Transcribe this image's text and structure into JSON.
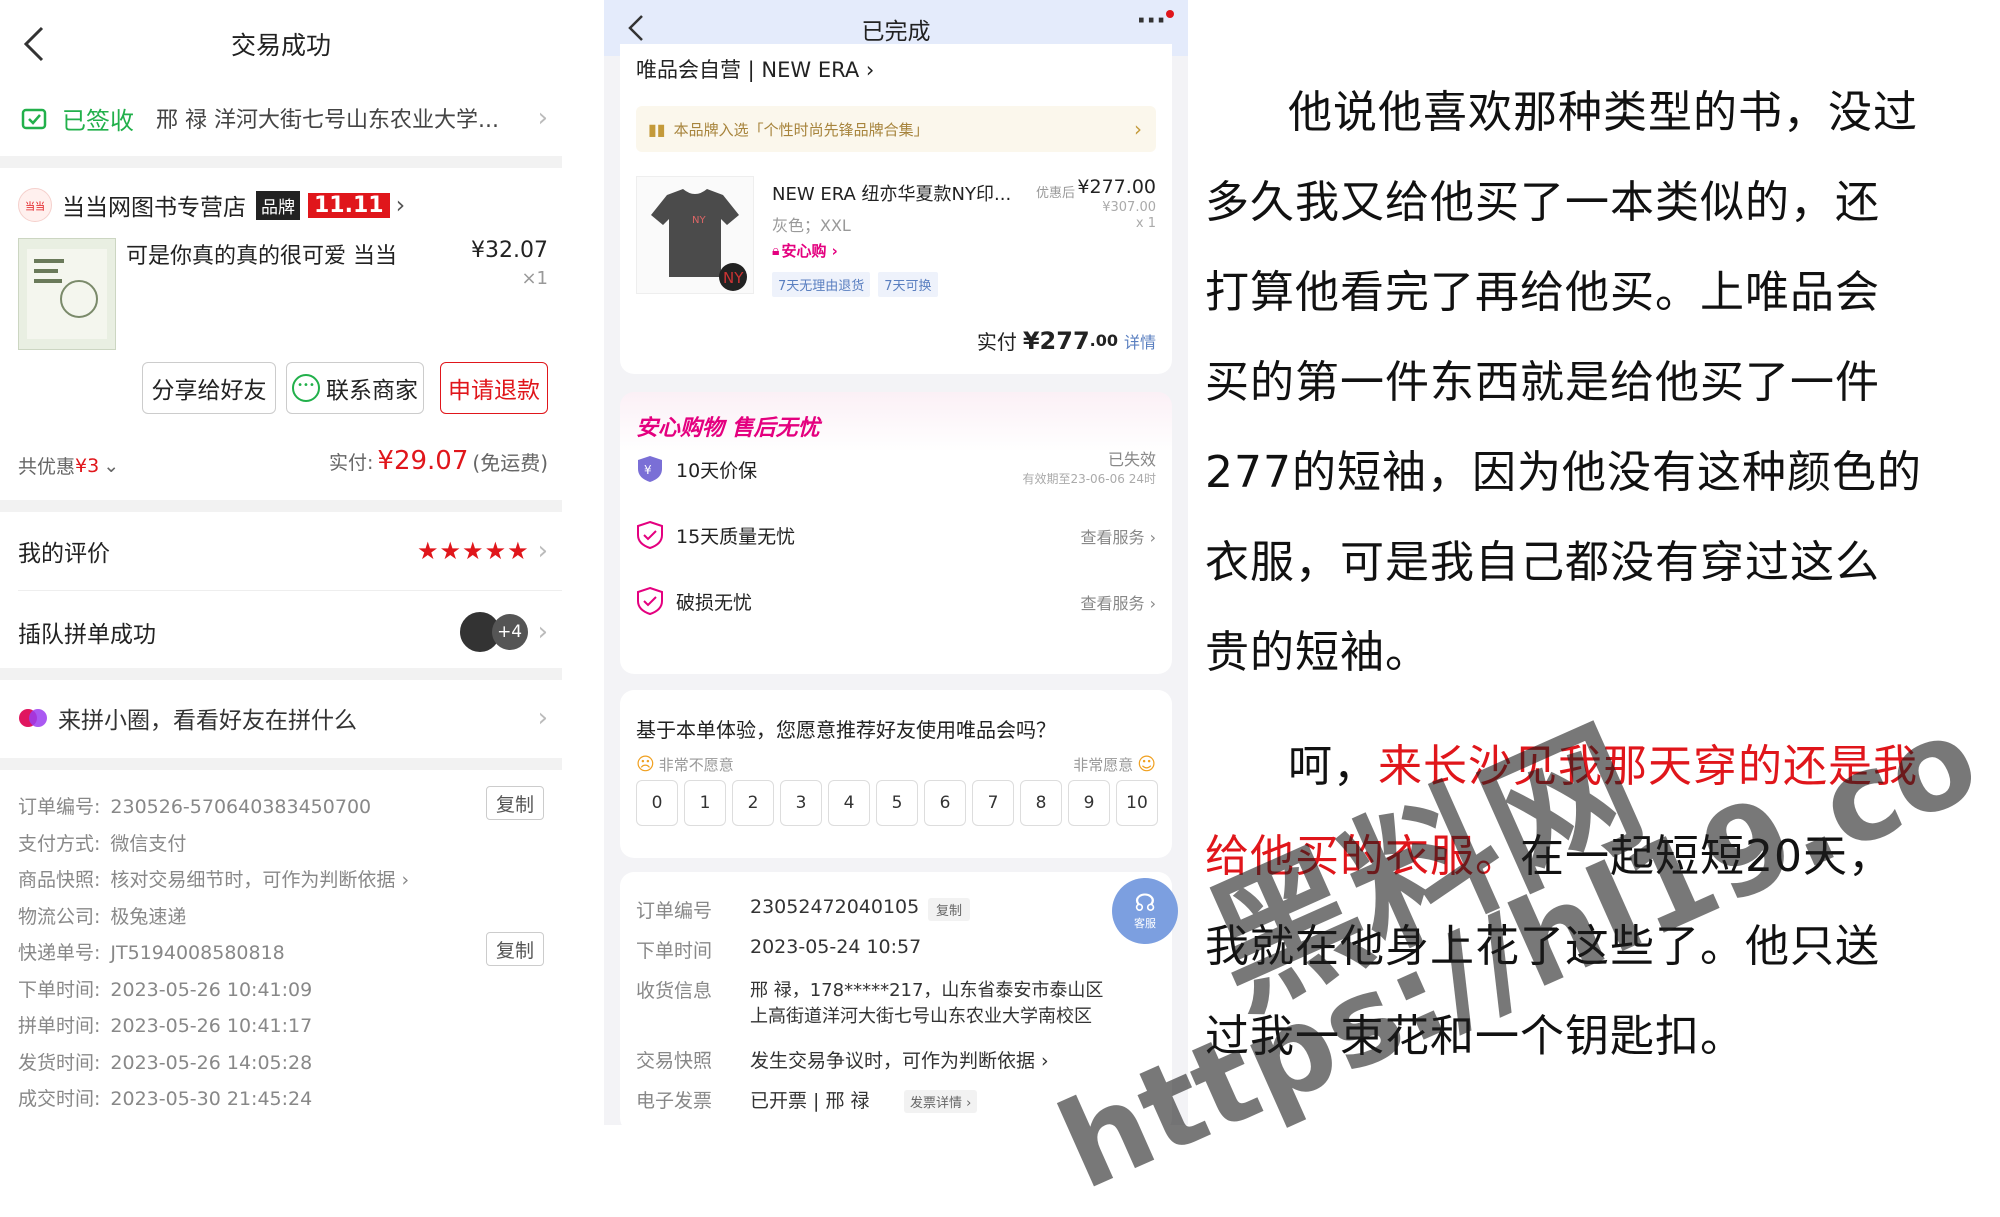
{
  "left": {
    "header_title": "交易成功",
    "signed_status": "已签收",
    "address": "邢  禄 洋河大街七号山东农业大学...",
    "store_logo_text": "当当",
    "store_name": "当当网图书专营店",
    "brand_badge": "品牌",
    "promo_badge": "11.11",
    "product_title": "可是你真的真的很可爱 当当",
    "product_price": "¥32.07",
    "product_qty": "×1",
    "buttons": {
      "share": "分享给好友",
      "contact": "联系商家",
      "refund": "申请退款"
    },
    "discount_label": "共优惠",
    "discount_value": "¥3",
    "paid_label": "实付:",
    "paid_value": "¥29.07",
    "shipping_note": "(免运费)",
    "review_label": "我的评价",
    "rating": 5,
    "group_label": "插队拼单成功",
    "group_extra": "+4",
    "circle_label": "来拼小圈，看看好友在拼什么",
    "copy_label": "复制",
    "order_info": [
      {
        "label": "订单编号:",
        "value": "230526-570640383450700",
        "copy": true
      },
      {
        "label": "支付方式:",
        "value": "微信支付"
      },
      {
        "label": "商品快照:",
        "value": "核对交易细节时，可作为判断依据 ›"
      },
      {
        "label": "物流公司:",
        "value": "极兔速递"
      },
      {
        "label": "快递单号:",
        "value": "JT5194008580818",
        "copy": true
      },
      {
        "label": "下单时间:",
        "value": "2023-05-26 10:41:09"
      },
      {
        "label": "拼单时间:",
        "value": "2023-05-26 10:41:17"
      },
      {
        "label": "发货时间:",
        "value": "2023-05-26 14:05:28"
      },
      {
        "label": "成交时间:",
        "value": "2023-05-30 21:45:24"
      }
    ]
  },
  "mid": {
    "header_title": "已完成",
    "more": "···",
    "store": "唯品会自营 | NEW ERA ›",
    "brand_note": "本品牌入选「个性时尚先锋品牌合集」",
    "product_title": "NEW ERA 纽亦华夏款NY印...",
    "product_spec": "灰色；XXL",
    "discount_tag": "优惠后",
    "price": "¥277.00",
    "orig_price": "¥307.00",
    "qty": "x 1",
    "assure": "安心购 ›",
    "tags": [
      "7天无理由退货",
      "7天可换"
    ],
    "paid_label": "实付",
    "paid_value": "¥277",
    "paid_cents": ".00",
    "detail_link": "详情",
    "service_title": "安心购物 售后无忧",
    "services": [
      {
        "name": "10天价保",
        "status": "已失效",
        "note": "有效期至23-06-06 24时"
      },
      {
        "name": "15天质量无忧",
        "status": "查看服务 ›"
      },
      {
        "name": "破损无忧",
        "status": "查看服务 ›"
      }
    ],
    "survey_q": "基于本单体验，您愿意推荐好友使用唯品会吗？",
    "survey_low": "非常不愿意",
    "survey_high": "非常愿意",
    "scores": [
      "0",
      "1",
      "2",
      "3",
      "4",
      "5",
      "6",
      "7",
      "8",
      "9",
      "10"
    ],
    "order_no_label": "订单编号",
    "order_no": "23052472040105",
    "copy_label": "复制",
    "order_time_label": "下单时间",
    "order_time": "2023-05-24 10:57",
    "addr_label": "收货信息",
    "addr_1": "邢  禄，178*****217，山东省泰安市泰山区",
    "addr_2": "上高街道洋河大街七号山东农业大学南校区",
    "snapshot_label": "交易快照",
    "snapshot": "发生交易争议时，可作为判断依据 ›",
    "invoice_label": "电子发票",
    "invoice": "已开票 | 邢  禄",
    "invoice_link": "发票详情 ›",
    "service_btn": "客服"
  },
  "right": {
    "lines": [
      "他说他喜欢那种类型的书，没过",
      "多久我又给他买了一本类似的，还",
      "打算他看完了再给他买。上唯品会",
      "买的第一件东西就是给他买了一件",
      "277的短袖，因为他没有这种颜色的",
      "衣服，可是我自己都没有穿过这么",
      "贵的短袖。"
    ],
    "line8_prefix": "呵，",
    "line8_red": "来长沙见我那天穿的还是我",
    "line9_red": "给他买的衣服。",
    "line9_rest": "在一起短短20天，",
    "line10": "我就在他身上花了这些了。他只送",
    "line11": "过我一束花和一个钥匙扣。"
  },
  "watermark": {
    "line1": "黑料网",
    "line2": "https://hl19.co"
  },
  "colors": {
    "red": "#e0161b",
    "green": "#22b04b",
    "vip_pink": "#e4007f",
    "vip_blue": "#6a8cd0"
  }
}
